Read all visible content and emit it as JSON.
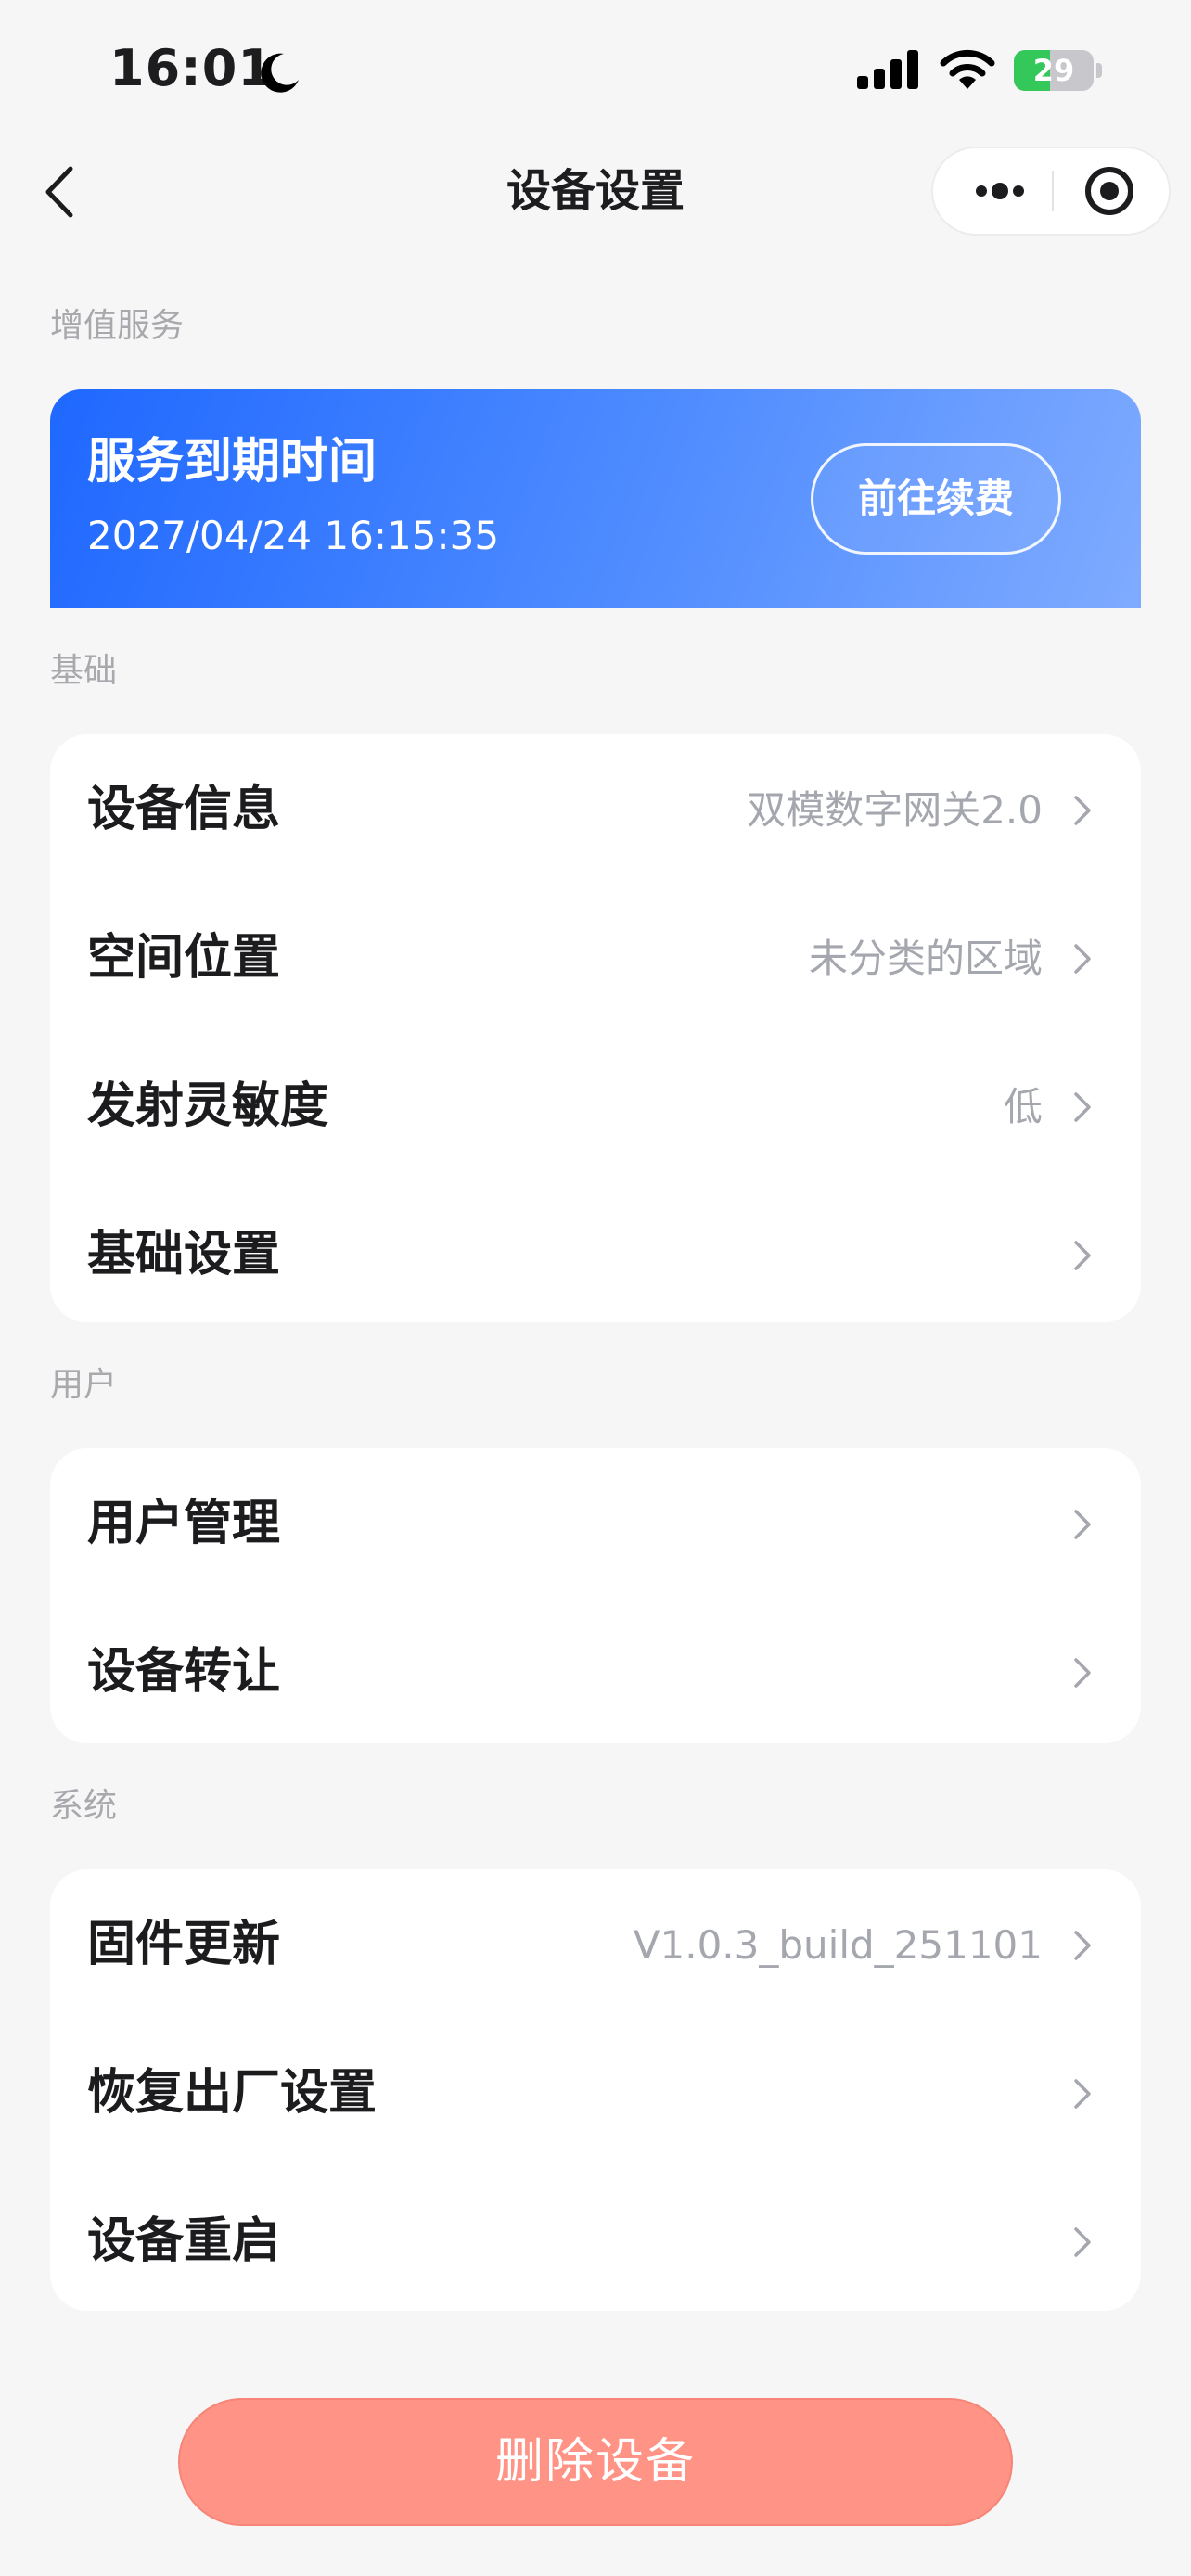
{
  "status_bar": {
    "time": "16:01",
    "battery": "29",
    "battery_level": 0.29,
    "icons": [
      "moon-icon",
      "cellular-signal-icon",
      "wifi-icon",
      "battery-charging-icon"
    ]
  },
  "nav": {
    "title": "设备设置",
    "icons": [
      "chevron-left-icon",
      "more-dots-icon",
      "target-icon"
    ]
  },
  "sections": {
    "value_added": "增值服务",
    "basic": "基础",
    "user": "用户",
    "system": "系统"
  },
  "service": {
    "title": "服务到期时间",
    "expire_time": "2027/04/24 16:15:35",
    "renew_button": "前往续费",
    "gradient": [
      "#1f68ff",
      "#7fabff"
    ]
  },
  "basic_rows": [
    {
      "label": "设备信息",
      "value": "双模数字网关2.0"
    },
    {
      "label": "空间位置",
      "value": "未分类的区域"
    },
    {
      "label": "发射灵敏度",
      "value": "低"
    },
    {
      "label": "基础设置",
      "value": ""
    }
  ],
  "user_rows": [
    {
      "label": "用户管理",
      "value": ""
    },
    {
      "label": "设备转让",
      "value": ""
    }
  ],
  "system_rows": [
    {
      "label": "固件更新",
      "value": "V1.0.3_build_251101"
    },
    {
      "label": "恢复出厂设置",
      "value": ""
    },
    {
      "label": "设备重启",
      "value": ""
    }
  ],
  "delete_button": "删除设备",
  "colors": {
    "background": "#f6f6f7",
    "delete": "#ff9486",
    "value_text": "#a5a7ae",
    "battery_green": "#34c759"
  }
}
